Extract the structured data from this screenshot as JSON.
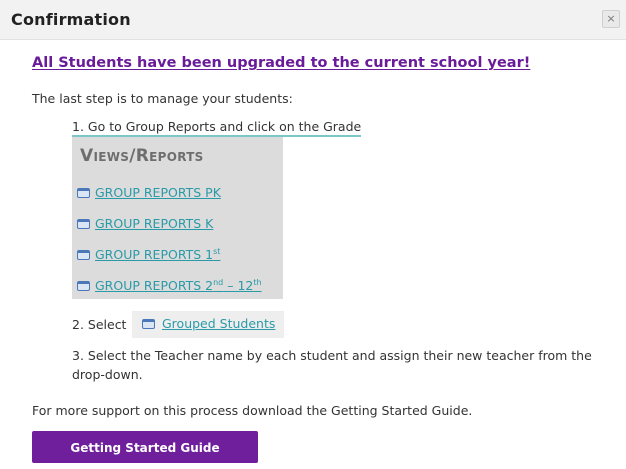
{
  "dialog": {
    "title": "Confirmation",
    "close_label": "×"
  },
  "content": {
    "headline": "All Students have been upgraded to the current school year!",
    "intro": "The last step is to manage your students:",
    "step1": "1. Go to Group Reports and click on the Grade",
    "views_title": "Views/Reports",
    "reports": [
      {
        "label": "GROUP REPORTS PK",
        "sup1": "",
        "mid": "",
        "sup2": ""
      },
      {
        "label": "GROUP REPORTS K",
        "sup1": "",
        "mid": "",
        "sup2": ""
      },
      {
        "label": "GROUP REPORTS 1",
        "sup1": "st",
        "mid": "",
        "sup2": ""
      },
      {
        "label": "GROUP REPORTS 2",
        "sup1": "nd",
        "mid": " – 12",
        "sup2": "th"
      }
    ],
    "step2_prefix": "2. Select",
    "grouped_students": "Grouped Students",
    "step3_line1": "3. Select the Teacher name by each student and assign their new teacher from the",
    "step3_line2": "drop-down.",
    "support_text": "For more support on this process download the Getting Started Guide.",
    "guide_button": "Getting Started Guide"
  },
  "colors": {
    "accent_purple": "#6f1f9c",
    "link_teal": "#2a9aa8",
    "panel_gray": "#dcdcdc"
  }
}
